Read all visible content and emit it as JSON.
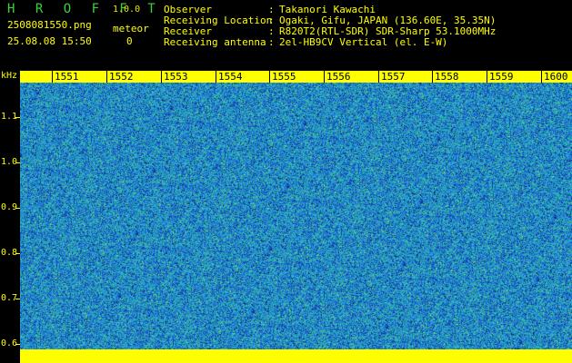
{
  "header": {
    "app_title": "H R O F F T",
    "app_version": "1.0.0",
    "filename": "2508081550.png",
    "datetime": "25.08.08 15:50",
    "meteor_label": "meteor",
    "meteor_count": "0"
  },
  "info": [
    {
      "label": "Observer",
      "sep": ":",
      "value": "Takanori Kawachi"
    },
    {
      "label": "Receiving Location",
      "sep": ":",
      "value": "Ogaki, Gifu, JAPAN (136.60E, 35.35N)"
    },
    {
      "label": "Receiver",
      "sep": ":",
      "value": "R820T2(RTL-SDR) SDR-Sharp 53.1000MHz"
    },
    {
      "label": "Receiving antenna",
      "sep": ":",
      "value": "2el-HB9CV Vertical (el. E-W)"
    }
  ],
  "time_axis": {
    "labels": [
      "1551",
      "1552",
      "1553",
      "1554",
      "1555",
      "1556",
      "1557",
      "1558",
      "1559",
      "1600"
    ]
  },
  "freq_axis": {
    "unit": "kHz",
    "labels": [
      "1.1",
      "1.0",
      "0.9",
      "0.8",
      "0.7",
      "0.6"
    ]
  },
  "colors": {
    "background": "#000000",
    "label_yellow": "#ffff00",
    "title_green": "#3cd13c",
    "noise_palette": [
      "#1a5fd0",
      "#2a8fd8",
      "#23b6c8",
      "#1d9a9a",
      "#3fc0a0",
      "#0c2d8a",
      "#7ad65a"
    ]
  }
}
